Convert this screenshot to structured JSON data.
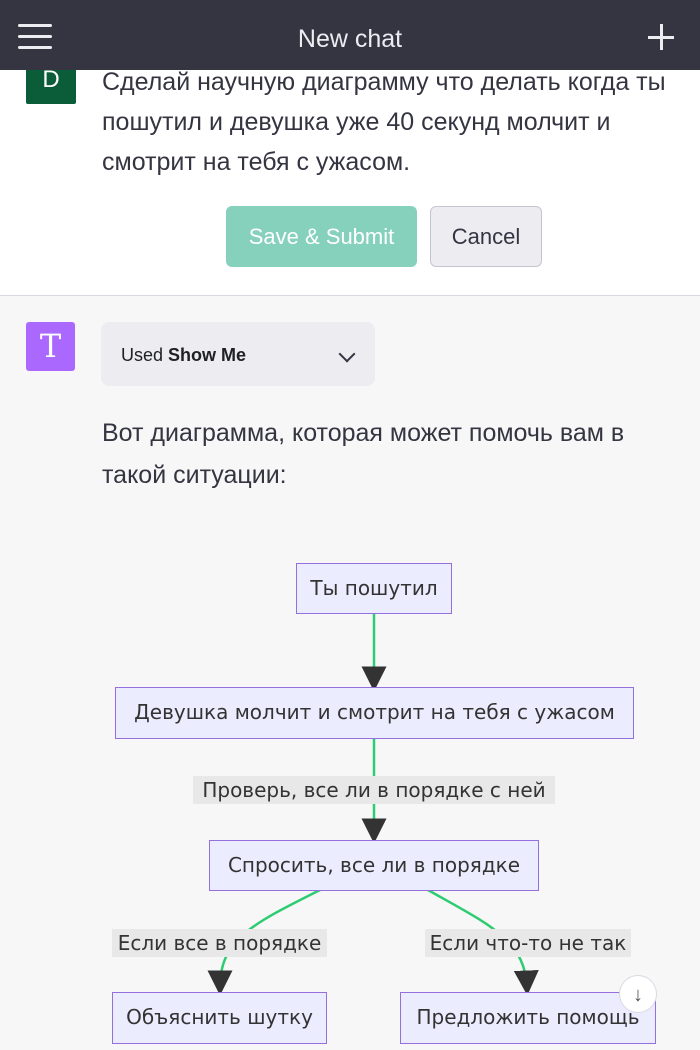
{
  "header": {
    "title": "New chat",
    "menu_icon": "hamburger-menu-icon",
    "new_chat_icon": "plus-icon"
  },
  "user_message": {
    "avatar_letter": "D",
    "text": "Сделай научную диаграмму что делать когда ты пошутил и девушка уже 40 секунд молчит и смотрит на тебя с ужасом.",
    "save_label": "Save & Submit",
    "cancel_label": "Cancel"
  },
  "assistant": {
    "avatar_letter": "T",
    "plugin": {
      "used_label": "Used",
      "name": "Show Me"
    },
    "text": "Вот диаграмма, которая может помочь вам в такой ситуации:"
  },
  "diagram": {
    "nodes": {
      "start": "Ты пошутил",
      "silent": "Девушка молчит и смотрит на тебя с ужасом",
      "ask": "Спросить, все ли в порядке",
      "explain": "Объяснить шутку",
      "help": "Предложить помощь"
    },
    "edges": {
      "check": "Проверь, все ли в порядке с ней",
      "if_ok": "Если все в порядке",
      "if_not": "Если что-то не так"
    },
    "colors": {
      "node_fill": "#ececff",
      "node_border": "#9370db",
      "edge": "#2ecc71",
      "arrow": "#333333"
    }
  },
  "scroll_down_icon": "arrow-down-icon"
}
